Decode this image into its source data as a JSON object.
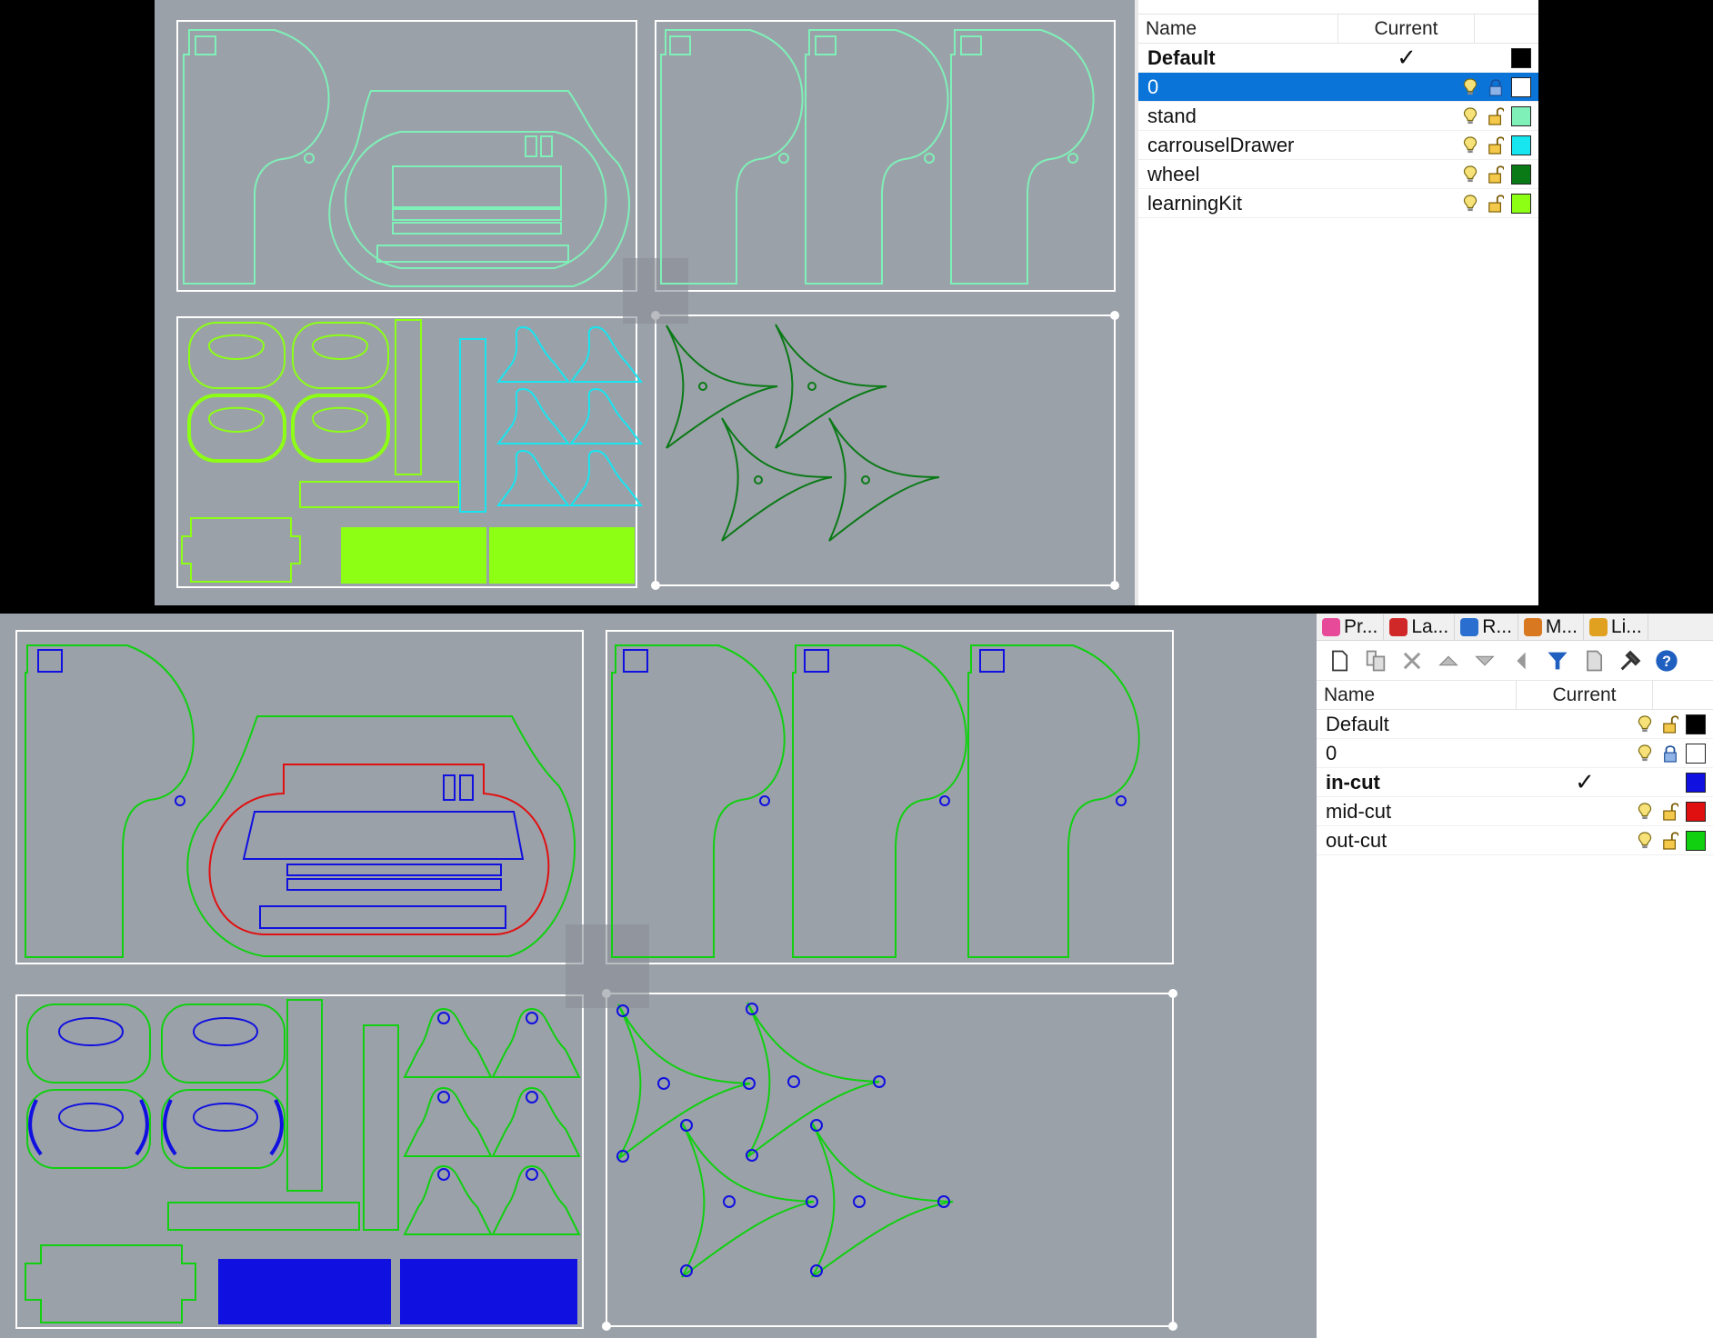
{
  "top_panel": {
    "header": {
      "name": "Name",
      "current": "Current"
    },
    "layers": [
      {
        "name": "Default",
        "current": "✓",
        "bold": true,
        "selected": false,
        "color": "#000000",
        "show_bulb": false,
        "show_lock": false
      },
      {
        "name": "0",
        "current": "",
        "bold": false,
        "selected": true,
        "color": "#ffffff",
        "show_bulb": true,
        "show_lock": true,
        "locked": true
      },
      {
        "name": "stand",
        "current": "",
        "bold": false,
        "selected": false,
        "color": "#7ff0b8",
        "show_bulb": true,
        "show_lock": true
      },
      {
        "name": "carrouselDrawer",
        "current": "",
        "bold": false,
        "selected": false,
        "color": "#17e6f0",
        "show_bulb": true,
        "show_lock": true
      },
      {
        "name": "wheel",
        "current": "",
        "bold": false,
        "selected": false,
        "color": "#0a7a16",
        "show_bulb": true,
        "show_lock": true
      },
      {
        "name": "learningKit",
        "current": "",
        "bold": false,
        "selected": false,
        "color": "#8cff14",
        "show_bulb": true,
        "show_lock": true
      }
    ]
  },
  "bottom_panel": {
    "tabs": [
      {
        "label": "Pr...",
        "icon": "properties-icon",
        "color": "#e84a9a"
      },
      {
        "label": "La...",
        "icon": "layers-icon",
        "color": "#d02828"
      },
      {
        "label": "R...",
        "icon": "render-icon",
        "color": "#2a6fd0"
      },
      {
        "label": "M...",
        "icon": "materials-icon",
        "color": "#d87820"
      },
      {
        "label": "Li...",
        "icon": "libraries-icon",
        "color": "#e0a020"
      }
    ],
    "toolbar": {
      "new_layer": "new-layer-icon",
      "new_sublayer": "new-sublayer-icon",
      "delete": "delete-icon",
      "move_up": "move-up-icon",
      "move_down": "move-down-icon",
      "move_left": "move-left-icon",
      "filter": "filter-icon",
      "copy": "copy-icon",
      "tools": "tools-icon",
      "help": "help-icon"
    },
    "header": {
      "name": "Name",
      "current": "Current"
    },
    "layers": [
      {
        "name": "Default",
        "current": "",
        "bold": false,
        "color": "#000000",
        "show_bulb": true,
        "show_lock": true
      },
      {
        "name": "0",
        "current": "",
        "bold": false,
        "color": "#ffffff",
        "show_bulb": true,
        "show_lock": true,
        "locked": true
      },
      {
        "name": "in-cut",
        "current": "✓",
        "bold": true,
        "color": "#1010e0",
        "show_bulb": false,
        "show_lock": false
      },
      {
        "name": "mid-cut",
        "current": "",
        "bold": false,
        "color": "#e01010",
        "show_bulb": true,
        "show_lock": true
      },
      {
        "name": "out-cut",
        "current": "",
        "bold": false,
        "color": "#10d010",
        "show_bulb": true,
        "show_lock": true
      }
    ]
  },
  "colors": {
    "viewport_bg": "#9ba1a9",
    "stand": "#7ff0b8",
    "drawer": "#17e6f0",
    "wheel": "#0a7a16",
    "kit": "#8cff14",
    "in_cut": "#1010e0",
    "mid_cut": "#e01010",
    "out_cut": "#10d010",
    "selection": "#0a74d8"
  }
}
